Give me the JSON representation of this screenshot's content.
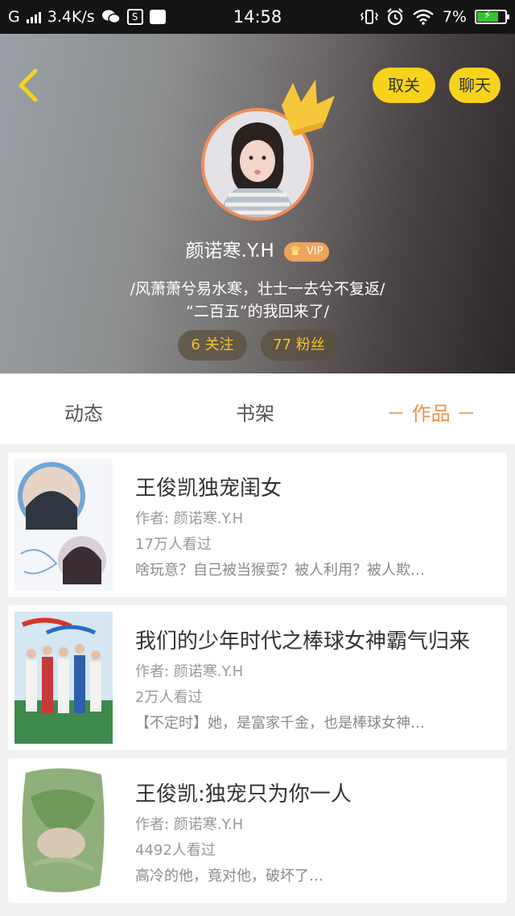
{
  "status_bar": {
    "network": "G",
    "speed": "3.4K/s",
    "time": "14:58",
    "battery": "7%",
    "icons": [
      "signal-icon",
      "wechat-icon",
      "s-app-icon",
      "mail-icon",
      "vibrate-icon",
      "alarm-icon",
      "wifi-icon",
      "battery-icon"
    ]
  },
  "header": {
    "back_icon": "chevron-left-icon",
    "unfollow_label": "取关",
    "chat_label": "聊天",
    "username": "颜诺寒.Y.H",
    "vip_label": "VIP",
    "signature_line1": "/风萧萧兮易水寒，壮士一去兮不复返/",
    "signature_line2": "“二百五”的我回来了/",
    "following": "6 关注",
    "followers": "77 粉丝",
    "accent_color": "#f8d31c",
    "crown_color": "#f6c73a"
  },
  "tabs": {
    "items": [
      "动态",
      "书架",
      "－ 作品 －"
    ],
    "active_index": 2,
    "active_color": "#f0914a"
  },
  "works": [
    {
      "title": "王俊凯独宠闺女",
      "author": "作者: 颜诺寒.Y.H",
      "views": "17万人看过",
      "desc": "啥玩意？自己被当猴耍？被人利用？被人欺…"
    },
    {
      "title": "我们的少年时代之棒球女神霸气归来",
      "author": "作者: 颜诺寒.Y.H",
      "views": "2万人看过",
      "desc": "【不定时】她，是富家千金，也是棒球女神…"
    },
    {
      "title": "王俊凯:独宠只为你一人",
      "author": "作者: 颜诺寒.Y.H",
      "views": "4492人看过",
      "desc": "高冷的他，竟对他，破坏了…"
    }
  ]
}
